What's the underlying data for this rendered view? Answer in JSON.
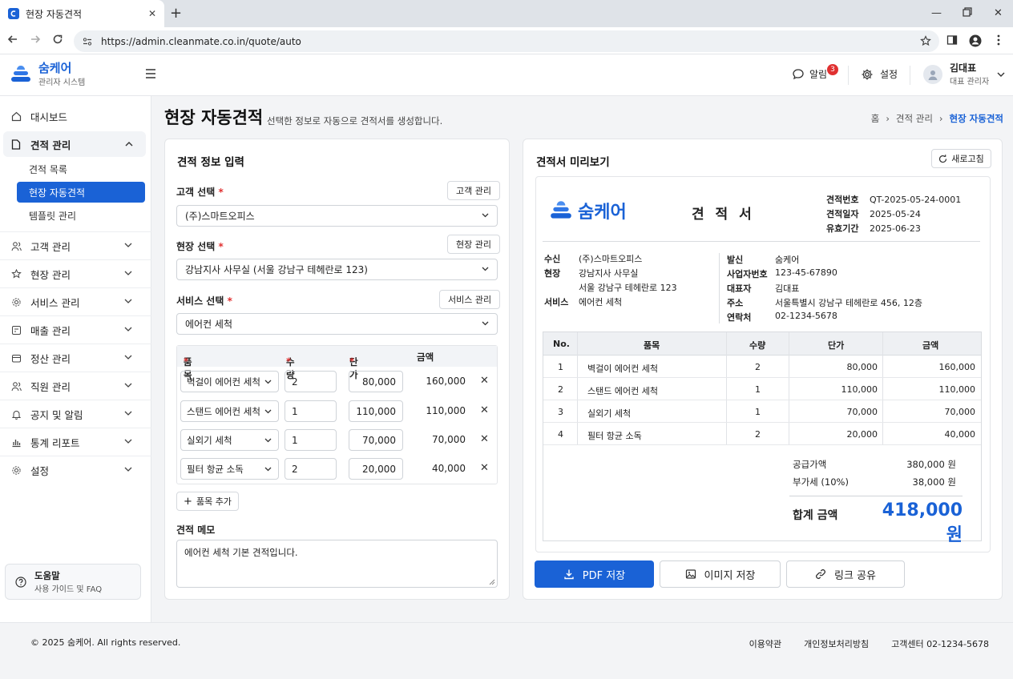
{
  "browser": {
    "tab_title": "현장 자동견적",
    "url": "https://admin.cleanmate.co.in/quote/auto"
  },
  "header": {
    "brand": "숨케어",
    "brand_sub": "관리자 시스템",
    "notifications_label": "알림",
    "notifications_count": "3",
    "settings_label": "설정",
    "user_name": "김대표",
    "user_role": "대표 관리자"
  },
  "sidebar": {
    "dashboard": "대시보드",
    "quote_group": "견적 관리",
    "quote_sub": [
      "견적 목록",
      "현장 자동견적",
      "템플릿 관리"
    ],
    "items": [
      "고객 관리",
      "현장 관리",
      "서비스 관리",
      "매출 관리",
      "정산 관리",
      "직원 관리",
      "공지 및 알림",
      "통계 리포트",
      "설정"
    ],
    "help_title": "도움말",
    "help_sub": "사용 가이드 및 FAQ"
  },
  "page": {
    "title": "현장 자동견적",
    "subtitle": "선택한 정보로 자동으로 견적서를 생성합니다.",
    "breadcrumb": [
      "홈",
      "견적 관리",
      "현장 자동견적"
    ]
  },
  "form": {
    "card_title": "견적 정보 입력",
    "customer_label": "고객 선택",
    "customer_btn": "고객 관리",
    "customer_value": "(주)스마트오피스",
    "site_label": "현장 선택",
    "site_btn": "현장 관리",
    "site_value": "강남지사 사무실 (서울 강남구 테헤란로 123)",
    "service_label": "서비스 선택",
    "service_btn": "서비스 관리",
    "service_value": "에어컨 세척",
    "col_item": "품목",
    "col_qty": "수량",
    "col_price": "단가",
    "col_amount": "금액",
    "rows": [
      {
        "item": "벽걸이 에어컨 세척",
        "qty": "2",
        "price": "80,000",
        "amount": "160,000"
      },
      {
        "item": "스탠드 에어컨 세척",
        "qty": "1",
        "price": "110,000",
        "amount": "110,000"
      },
      {
        "item": "실외기 세척",
        "qty": "1",
        "price": "70,000",
        "amount": "70,000"
      },
      {
        "item": "필터 항균 소독",
        "qty": "2",
        "price": "20,000",
        "amount": "40,000"
      }
    ],
    "add_item": "품목 추가",
    "memo_label": "견적 메모",
    "memo_value": "에어컨 세척 기본 견적입니다."
  },
  "preview": {
    "card_title": "견적서 미리보기",
    "refresh": "새로고침",
    "doc_brand": "숨케어",
    "doc_title": "견 적 서",
    "quote_no_label": "견적번호",
    "quote_no": "QT-2025-05-24-0001",
    "quote_date_label": "견적일자",
    "quote_date": "2025-05-24",
    "valid_label": "유효기간",
    "valid_date": "2025-06-23",
    "to_label": "수신",
    "to_value": "(주)스마트오피스",
    "site_label": "현장",
    "site_line1": "강남지사 사무실",
    "site_line2": "서울 강남구 테헤란로 123",
    "service_label": "서비스",
    "service_value": "에어컨 세척",
    "from_label": "발신",
    "from_value": "숨케어",
    "bizno_label": "사업자번호",
    "bizno_value": "123-45-67890",
    "ceo_label": "대표자",
    "ceo_value": "김대표",
    "addr_label": "주소",
    "addr_value": "서울특별시 강남구 테헤란로 456, 12층",
    "contact_label": "연락처",
    "contact_value": "02-1234-5678",
    "col_no": "No.",
    "col_item": "품목",
    "col_qty": "수량",
    "col_price": "단가",
    "col_amount": "금액",
    "rows": [
      {
        "no": "1",
        "item": "벽걸이 에어컨 세척",
        "qty": "2",
        "price": "80,000",
        "amount": "160,000"
      },
      {
        "no": "2",
        "item": "스탠드 에어컨 세척",
        "qty": "1",
        "price": "110,000",
        "amount": "110,000"
      },
      {
        "no": "3",
        "item": "실외기 세척",
        "qty": "1",
        "price": "70,000",
        "amount": "70,000"
      },
      {
        "no": "4",
        "item": "필터 항균 소독",
        "qty": "2",
        "price": "20,000",
        "amount": "40,000"
      }
    ],
    "supply_label": "공급가액",
    "supply_value": "380,000 원",
    "vat_label": "부가세 (10%)",
    "vat_value": "38,000 원",
    "total_label": "합계 금액",
    "total_value": "418,000 원",
    "pdf_btn": "PDF 저장",
    "image_btn": "이미지 저장",
    "share_btn": "링크 공유"
  },
  "footer": {
    "copyright": "© 2025 숨케어. All rights reserved.",
    "terms": "이용약관",
    "privacy": "개인정보처리방침",
    "support": "고객센터 02-1234-5678"
  },
  "colors": {
    "accent": "#1a62d6",
    "badge": "#e03131"
  },
  "icons": [
    "home-icon",
    "document-icon",
    "users-icon",
    "building-icon",
    "gear-icon",
    "calculator-icon",
    "wallet-icon",
    "bell-icon",
    "chart-icon",
    "bubble-icon",
    "hamburger-icon",
    "refresh-icon",
    "download-icon",
    "image-icon",
    "link-icon",
    "help-icon"
  ]
}
